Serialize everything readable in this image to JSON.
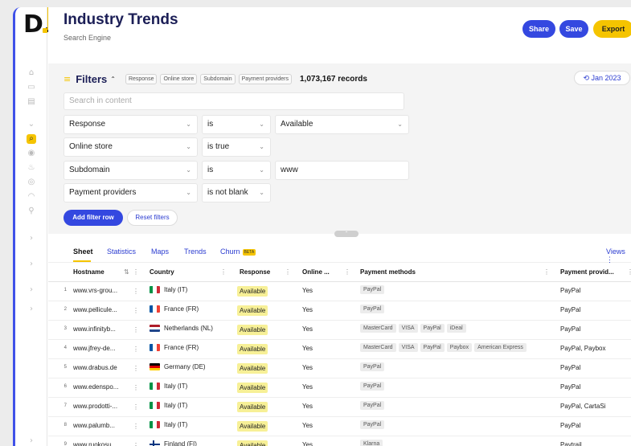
{
  "app": {
    "title": "Industry Trends",
    "subtitle": "Search Engine",
    "logo": "D."
  },
  "header": {
    "share_label": "Share",
    "save_label": "Save",
    "export_label": "Export"
  },
  "filters": {
    "title": "Filters",
    "chips": [
      "Response",
      "Online store",
      "Subdomain",
      "Payment providers"
    ],
    "record_count": "1,073,167 records",
    "date_label": "Jan 2023",
    "search_placeholder": "Search in content",
    "rows": [
      {
        "field": "Response",
        "operator": "is",
        "value": "Available"
      },
      {
        "field": "Online store",
        "operator": "is true",
        "value": ""
      },
      {
        "field": "Subdomain",
        "operator": "is",
        "value": "www"
      },
      {
        "field": "Payment providers",
        "operator": "is not blank",
        "value": ""
      }
    ],
    "add_label": "Add filter row",
    "reset_label": "Reset filters"
  },
  "tabs": {
    "items": [
      "Sheet",
      "Statistics",
      "Maps",
      "Trends",
      "Churn"
    ],
    "beta": "BETA",
    "views": "Views"
  },
  "table": {
    "columns": [
      "Hostname",
      "Country",
      "Response",
      "Online ...",
      "Payment methods",
      "Payment provid..."
    ],
    "rows": [
      {
        "n": "1",
        "host": "www.vrs-grou...",
        "country": "Italy (IT)",
        "flag": "it",
        "response": "Available",
        "online": "Yes",
        "methods": [
          "PayPal"
        ],
        "providers": "PayPal"
      },
      {
        "n": "2",
        "host": "www.pellicule...",
        "country": "France (FR)",
        "flag": "fr",
        "response": "Available",
        "online": "Yes",
        "methods": [
          "PayPal"
        ],
        "providers": "PayPal"
      },
      {
        "n": "3",
        "host": "www.infinityb...",
        "country": "Netherlands (NL)",
        "flag": "nl",
        "response": "Available",
        "online": "Yes",
        "methods": [
          "MasterCard",
          "VISA",
          "PayPal",
          "iDeal"
        ],
        "providers": "PayPal"
      },
      {
        "n": "4",
        "host": "www.jfrey-de...",
        "country": "France (FR)",
        "flag": "fr",
        "response": "Available",
        "online": "Yes",
        "methods": [
          "MasterCard",
          "VISA",
          "PayPal",
          "Paybox",
          "American Express"
        ],
        "providers": "PayPal, Paybox"
      },
      {
        "n": "5",
        "host": "www.drabus.de",
        "country": "Germany (DE)",
        "flag": "de",
        "response": "Available",
        "online": "Yes",
        "methods": [
          "PayPal"
        ],
        "providers": "PayPal"
      },
      {
        "n": "6",
        "host": "www.edenspo...",
        "country": "Italy (IT)",
        "flag": "it",
        "response": "Available",
        "online": "Yes",
        "methods": [
          "PayPal"
        ],
        "providers": "PayPal"
      },
      {
        "n": "7",
        "host": "www.prodotti-...",
        "country": "Italy (IT)",
        "flag": "it",
        "response": "Available",
        "online": "Yes",
        "methods": [
          "PayPal"
        ],
        "providers": "PayPal, CartaSi"
      },
      {
        "n": "8",
        "host": "www.palumb...",
        "country": "Italy (IT)",
        "flag": "it",
        "response": "Available",
        "online": "Yes",
        "methods": [
          "PayPal"
        ],
        "providers": "PayPal"
      },
      {
        "n": "9",
        "host": "www.ruokosu...",
        "country": "Finland (FI)",
        "flag": "fi",
        "response": "Available",
        "online": "Yes",
        "methods": [
          "Klarna"
        ],
        "providers": "Paytrail"
      }
    ]
  },
  "colors": {
    "accent": "#f5c400",
    "primary": "#3448e0",
    "title": "#1b1e56"
  }
}
